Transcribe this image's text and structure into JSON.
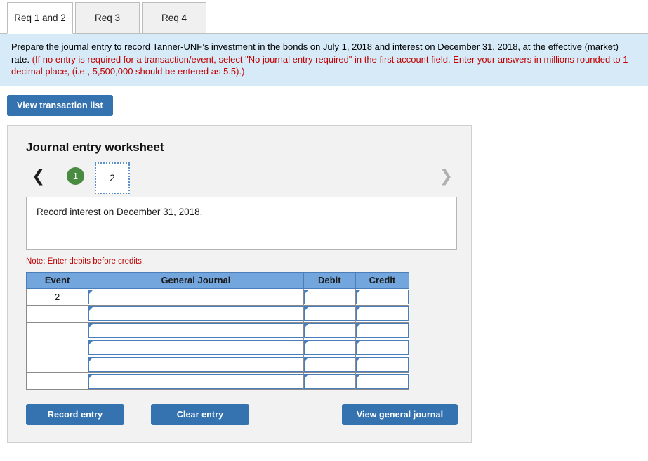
{
  "tabs": [
    {
      "label": "Req 1 and 2",
      "active": true
    },
    {
      "label": "Req 3",
      "active": false
    },
    {
      "label": "Req 4",
      "active": false
    }
  ],
  "instructions": {
    "line1_black": "Prepare the journal entry to record Tanner-UNF’s investment in the bonds on July 1, 2018 and interest on December 31, 2018, at the effective (market) rate. ",
    "line1_red": "(If no entry is required for a transaction/event, select \"No journal entry required\" in the first account field. Enter your answers in millions rounded to 1 decimal place, (i.e., 5,500,000 should be entered as 5.5).)"
  },
  "toolbar": {
    "view_transaction_list_label": "View transaction list"
  },
  "worksheet": {
    "title": "Journal entry worksheet",
    "pager": {
      "prev_icon": "chevron-left-icon",
      "next_icon": "chevron-right-icon",
      "pages": [
        {
          "label": "1",
          "state": "completed"
        },
        {
          "label": "2",
          "state": "active"
        }
      ]
    },
    "description": "Record interest on December 31, 2018.",
    "note": "Note: Enter debits before credits.",
    "table": {
      "headers": [
        "Event",
        "General Journal",
        "Debit",
        "Credit"
      ],
      "rows": [
        {
          "event": "2",
          "general_journal": "",
          "debit": "",
          "credit": ""
        },
        {
          "event": "",
          "general_journal": "",
          "debit": "",
          "credit": ""
        },
        {
          "event": "",
          "general_journal": "",
          "debit": "",
          "credit": ""
        },
        {
          "event": "",
          "general_journal": "",
          "debit": "",
          "credit": ""
        },
        {
          "event": "",
          "general_journal": "",
          "debit": "",
          "credit": ""
        },
        {
          "event": "",
          "general_journal": "",
          "debit": "",
          "credit": ""
        }
      ]
    },
    "actions": {
      "record_entry_label": "Record entry",
      "clear_entry_label": "Clear entry",
      "view_general_journal_label": "View general journal"
    }
  },
  "colors": {
    "banner_bg": "#d6eaf8",
    "accent_blue": "#3572b0",
    "table_header_blue": "#74a6de",
    "red_text": "#c00000",
    "green_badge": "#4a8b42"
  }
}
